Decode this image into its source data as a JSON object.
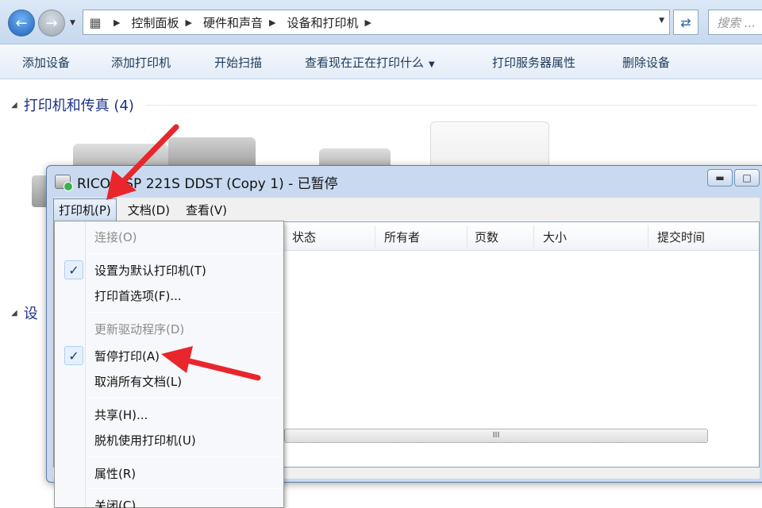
{
  "explorer": {
    "breadcrumbs": [
      "控制面板",
      "硬件和声音",
      "设备和打印机"
    ],
    "search_placeholder": "搜索 ..."
  },
  "commands": [
    {
      "label": "添加设备",
      "name": "add-device-command"
    },
    {
      "label": "添加打印机",
      "name": "add-printer-command"
    },
    {
      "label": "开始扫描",
      "name": "start-scan-command"
    },
    {
      "label": "查看现在正在打印什么",
      "name": "see-whats-printing-command",
      "dropdown": true
    },
    {
      "label": "打印服务器属性",
      "name": "print-server-properties-command"
    },
    {
      "label": "删除设备",
      "name": "remove-device-command"
    }
  ],
  "groups": {
    "printers_fax": "打印机和传真 (4)",
    "devices_partial": "设"
  },
  "queue_window": {
    "title": "RICOH SP 221S DDST (Copy 1) - 已暂停",
    "menus": [
      "打印机(P)",
      "文档(D)",
      "查看(V)"
    ],
    "columns": [
      "状态",
      "所有者",
      "页数",
      "大小",
      "提交时间"
    ],
    "scroll_grip": "III"
  },
  "printer_menu": {
    "items": [
      {
        "label": "连接(O)",
        "disabled": true,
        "checked": false
      },
      {
        "label": "设置为默认打印机(T)",
        "disabled": false,
        "checked": true
      },
      {
        "label": "打印首选项(F)...",
        "disabled": false,
        "checked": false
      },
      {
        "label": "更新驱动程序(D)",
        "disabled": true,
        "checked": false
      },
      {
        "label": "暂停打印(A)",
        "disabled": false,
        "checked": true
      },
      {
        "label": "取消所有文档(L)",
        "disabled": false,
        "checked": false
      },
      {
        "label": "共享(H)...",
        "disabled": false,
        "checked": false
      },
      {
        "label": "脱机使用打印机(U)",
        "disabled": false,
        "checked": false
      },
      {
        "label": "属性(R)",
        "disabled": false,
        "checked": false
      },
      {
        "label": "关闭(C)",
        "disabled": false,
        "checked": false
      }
    ]
  },
  "colors": {
    "annotation_arrow": "#e8262c",
    "group_header": "#1e3287",
    "window_frame": "#c9daf0"
  }
}
